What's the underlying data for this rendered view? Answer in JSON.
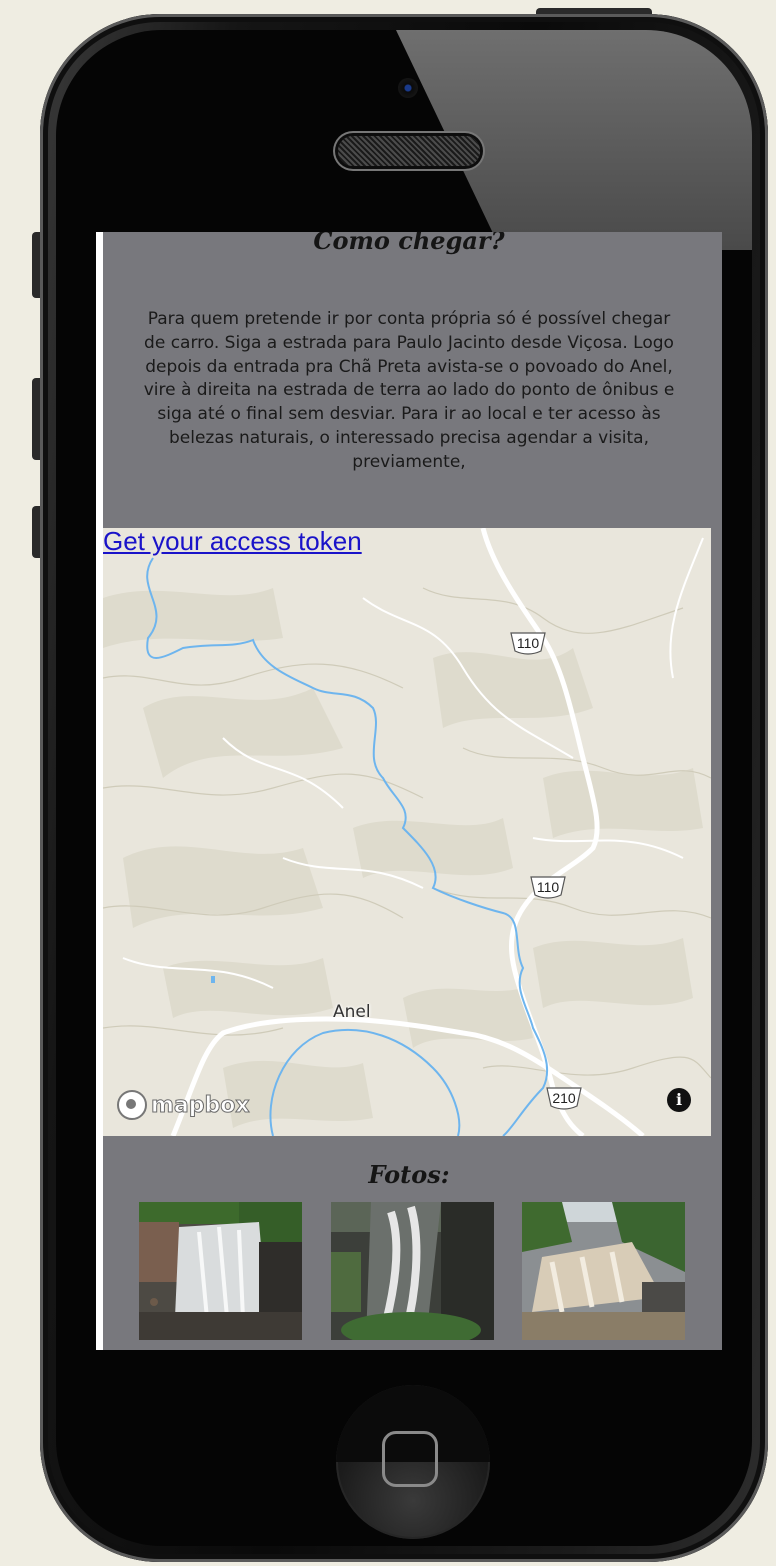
{
  "section_title": "Como chegar?",
  "directions_text": "Para quem pretende ir por conta própria só é possível chegar de carro. Siga a estrada para Paulo Jacinto desde Viçosa. Logo depois da entrada pra Chã Preta avista-se o povoado do Anel, vire à direita na estrada de terra ao lado do ponto de ônibus e siga até o final sem desviar. Para ir ao local e ter acesso às belezas naturais, o interessado precisa agendar a visita, previamente,",
  "map": {
    "token_link": "Get your access token",
    "road_shields": [
      "110",
      "110",
      "210"
    ],
    "place_label": "Anel",
    "logo_text": "mapbox",
    "info_icon": "info-icon"
  },
  "photos_title": "Fotos:",
  "photos": [
    "waterfall-photo-1",
    "waterfall-photo-2",
    "waterfall-photo-3"
  ],
  "colors": {
    "screen_bg": "#78787d",
    "map_bg": "#e9e6dc",
    "water": "#6eb5ee",
    "link": "#1a13c9",
    "page_bg": "#efede2"
  }
}
